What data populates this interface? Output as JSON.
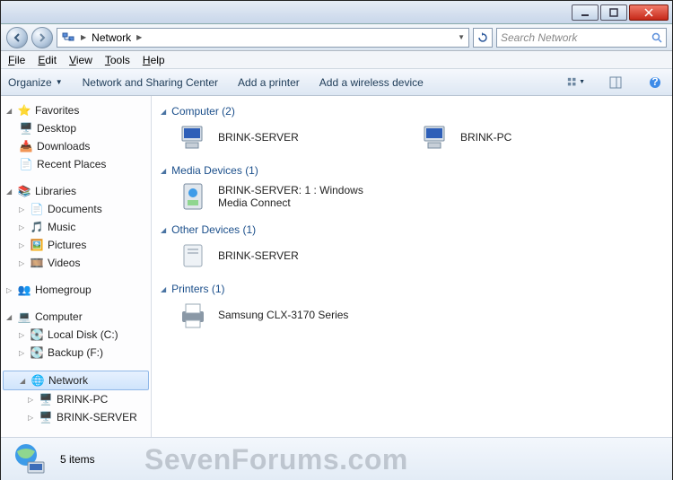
{
  "window": {
    "title": "Network"
  },
  "nav": {
    "path": "Network",
    "search_placeholder": "Search Network"
  },
  "menubar": [
    "File",
    "Edit",
    "View",
    "Tools",
    "Help"
  ],
  "cmdbar": {
    "organize": "Organize",
    "items": [
      "Network and Sharing Center",
      "Add a printer",
      "Add a wireless device"
    ]
  },
  "sidebar": {
    "favorites": {
      "label": "Favorites",
      "items": [
        "Desktop",
        "Downloads",
        "Recent Places"
      ]
    },
    "libraries": {
      "label": "Libraries",
      "items": [
        "Documents",
        "Music",
        "Pictures",
        "Videos"
      ]
    },
    "homegroup": {
      "label": "Homegroup"
    },
    "computer": {
      "label": "Computer",
      "items": [
        "Local Disk (C:)",
        "Backup (F:)"
      ]
    },
    "network": {
      "label": "Network",
      "items": [
        "BRINK-PC",
        "BRINK-SERVER"
      ]
    }
  },
  "content": {
    "categories": [
      {
        "name": "Computer",
        "count": 2,
        "items": [
          "BRINK-SERVER",
          "BRINK-PC"
        ]
      },
      {
        "name": "Media Devices",
        "count": 1,
        "items": [
          "BRINK-SERVER: 1 : Windows Media Connect"
        ]
      },
      {
        "name": "Other Devices",
        "count": 1,
        "items": [
          "BRINK-SERVER"
        ]
      },
      {
        "name": "Printers",
        "count": 1,
        "items": [
          "Samsung CLX-3170 Series"
        ]
      }
    ]
  },
  "details": {
    "count_text": "5 items"
  },
  "watermark": "SevenForums.com"
}
